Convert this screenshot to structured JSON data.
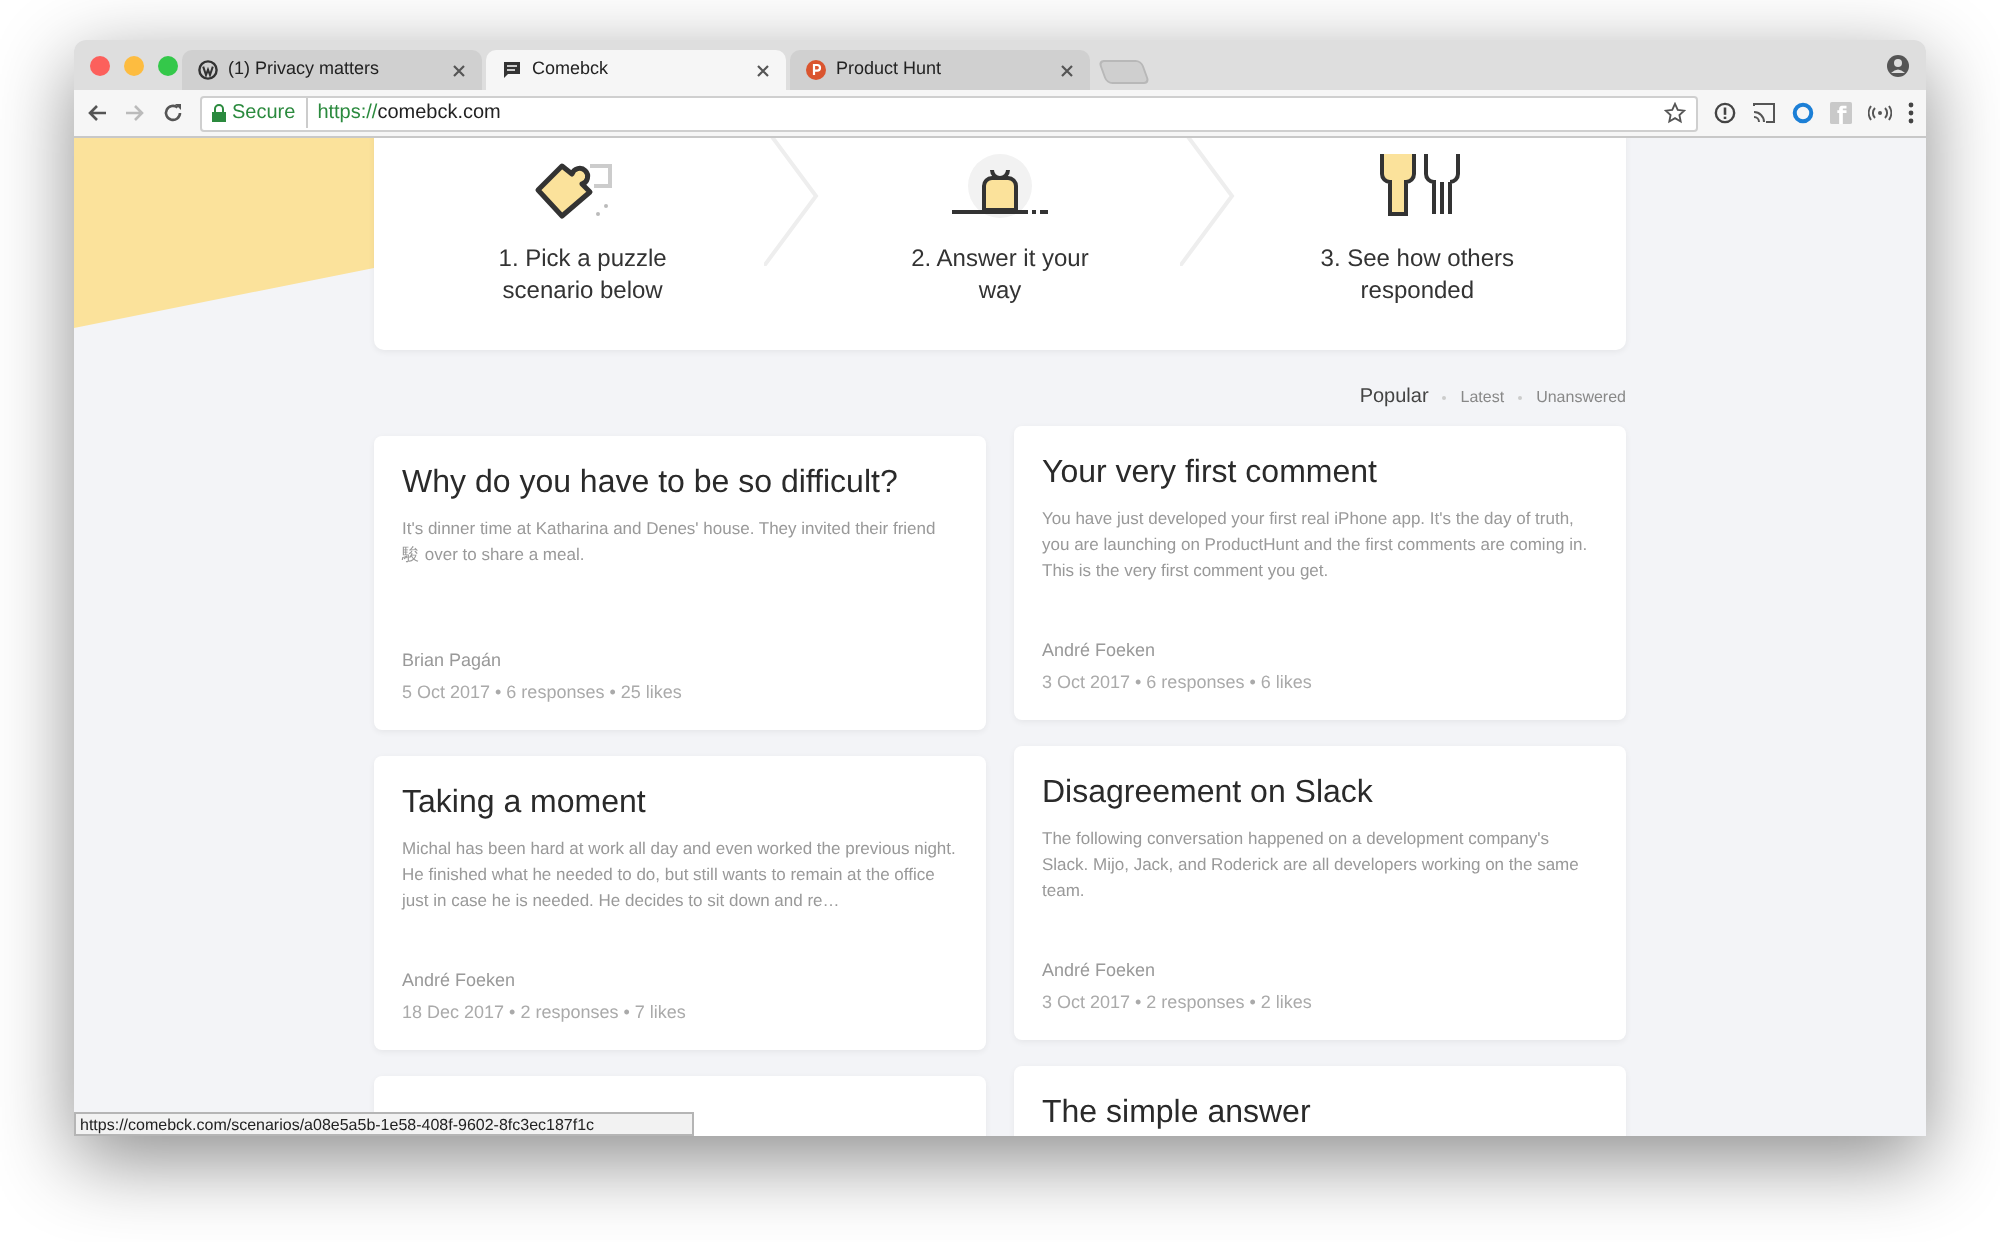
{
  "tabs": [
    {
      "title": "(1) Privacy matters",
      "kind": "wordpress",
      "selected": false
    },
    {
      "title": "Comebck",
      "kind": "chat",
      "selected": true
    },
    {
      "title": "Product Hunt",
      "kind": "producthunt",
      "selected": false
    }
  ],
  "address": {
    "secure_label": "Secure",
    "scheme": "https://",
    "host": "comebck.com"
  },
  "steps": [
    "1. Pick a puzzle scenario below",
    "2. Answer it your way",
    "3. See how others responded"
  ],
  "filters": [
    {
      "label": "Popular",
      "selected": true
    },
    {
      "label": "Latest",
      "selected": false
    },
    {
      "label": "Unanswered",
      "selected": false
    }
  ],
  "columns": [
    [
      {
        "kind": "full",
        "title": "Why do you have to be so difficult?",
        "excerpt": "It's dinner time at Katharina and Denes' house. They invited their friend 駿 over to share a meal.",
        "author": "Brian Pagán",
        "meta": "5 Oct 2017 • 6 responses • 25 likes"
      },
      {
        "kind": "full",
        "title": "Taking a moment",
        "excerpt": "Michal has been hard at work all day and even worked the previous night. He finished what he needed to do, but still wants to remain at the office just in case he is needed. He decides to sit down and re…",
        "author": "André Foeken",
        "meta": "18 Dec 2017 • 2 responses • 7 likes"
      },
      {
        "kind": "partial"
      }
    ],
    [
      {
        "kind": "full",
        "title": "Your very first comment",
        "excerpt": "You have just developed your first real iPhone app. It's the day of truth, you are launching on ProductHunt and the first comments are coming in. This is the very first comment you get.",
        "author": "André Foeken",
        "meta": "3 Oct 2017 • 6 responses • 6 likes"
      },
      {
        "kind": "full",
        "title": "Disagreement on Slack",
        "excerpt": "The following conversation happened on a development company's Slack. Mijo, Jack, and Roderick are all developers working on the same team.",
        "author": "André Foeken",
        "meta": "3 Oct 2017 • 2 responses • 2 likes"
      },
      {
        "kind": "partial",
        "title": "The simple answer"
      }
    ]
  ],
  "status_url": "https://comebck.com/scenarios/a08e5a5b-1e58-408f-9602-8fc3ec187f1c"
}
